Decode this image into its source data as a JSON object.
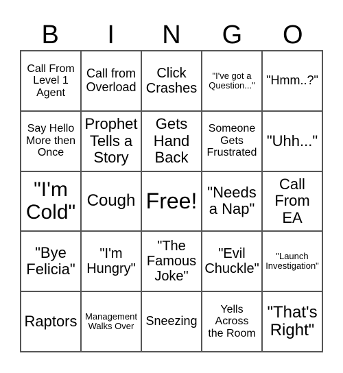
{
  "title_letters": [
    "B",
    "I",
    "N",
    "G",
    "O"
  ],
  "cells": [
    "Call From\nLevel 1\nAgent",
    "Call from\nOverload",
    "Click\nCrashes",
    "\"I've got a\nQuestion...\"",
    "\"Hmm..?\"",
    "Say Hello\nMore then\nOnce",
    "Prophet\nTells a\nStory",
    "Gets\nHand\nBack",
    "Someone\nGets\nFrustrated",
    "\"Uhh...\"",
    "\"I'm\nCold\"",
    "Cough",
    "Free!",
    "\"Needs\na Nap\"",
    "Call\nFrom\nEA",
    "\"Bye\nFelicia\"",
    "\"I'm\nHungry\"",
    "\"The\nFamous\nJoke\"",
    "\"Evil\nChuckle\"",
    "\"Launch\nInvestigation\"",
    "Raptors",
    "Management\nWalks Over",
    "Sneezing",
    "Yells\nAcross\nthe Room",
    "\"That's\nRight\""
  ]
}
